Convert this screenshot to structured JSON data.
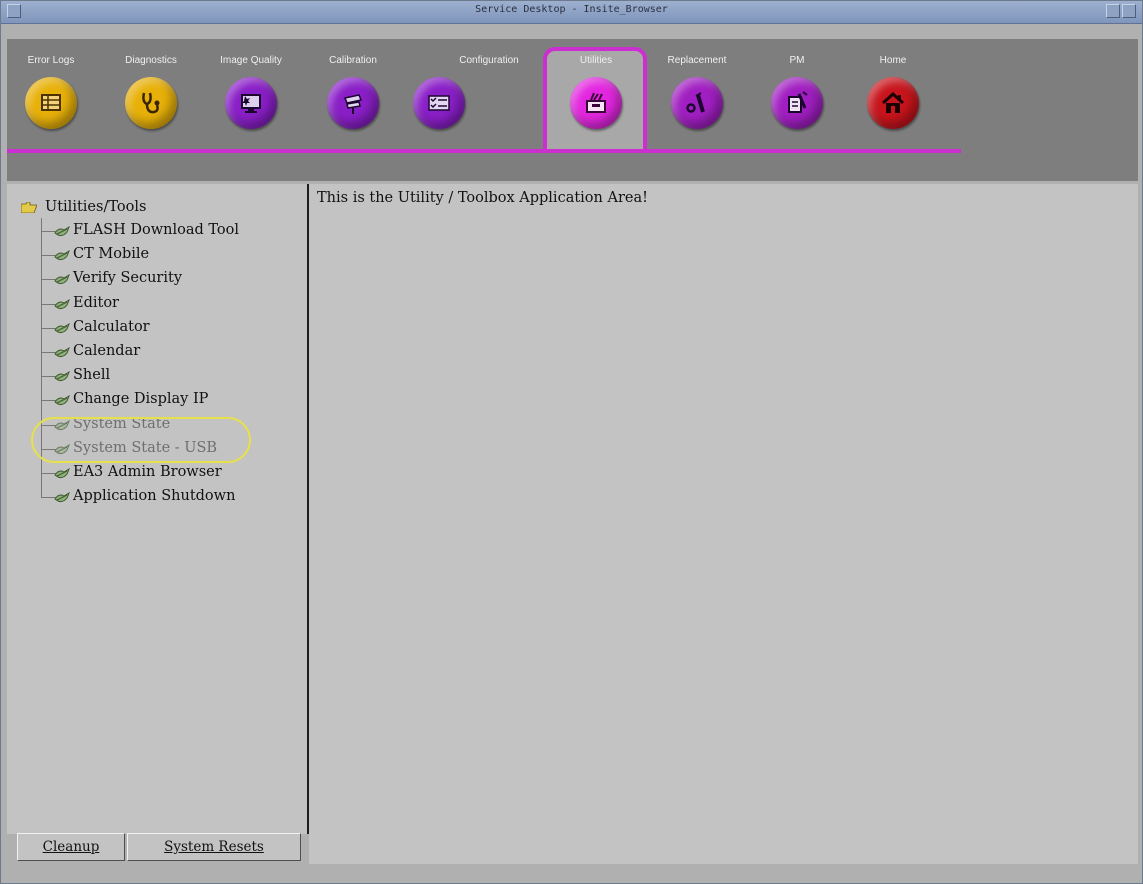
{
  "window": {
    "title": "Service Desktop - Insite_Browser"
  },
  "tabs": [
    {
      "label": "Error Logs",
      "icon": "error-logs-icon",
      "color": "#e8b10a"
    },
    {
      "label": "Diagnostics",
      "icon": "stethoscope-icon",
      "color": "#e8b10a"
    },
    {
      "label": "Image Quality",
      "icon": "monitor-icon",
      "color": "#8a1fc8"
    },
    {
      "label": "Calibration",
      "icon": "calibration-icon",
      "color": "#8a1fc8"
    },
    {
      "label": "Configuration",
      "icon": "checklist-icon",
      "color": "#8a1fc8"
    },
    {
      "label": "Utilities",
      "icon": "toolbox-icon",
      "color": "#e327e0",
      "active": true
    },
    {
      "label": "Replacement",
      "icon": "wrench-icon",
      "color": "#a11fc2"
    },
    {
      "label": "PM",
      "icon": "pm-icon",
      "color": "#a11fc2"
    },
    {
      "label": "Home",
      "icon": "home-icon",
      "color": "#c8141c"
    }
  ],
  "sidebar": {
    "root_label": "Utilities/Tools",
    "items": [
      {
        "label": "FLASH Download Tool"
      },
      {
        "label": "CT Mobile"
      },
      {
        "label": "Verify Security"
      },
      {
        "label": "Editor"
      },
      {
        "label": "Calculator"
      },
      {
        "label": "Calendar"
      },
      {
        "label": "Shell"
      },
      {
        "label": "Change Display IP"
      },
      {
        "label": "System State",
        "disabled": true
      },
      {
        "label": "System State - USB",
        "disabled": true
      },
      {
        "label": "EA3 Admin Browser"
      },
      {
        "label": "Application Shutdown"
      }
    ],
    "buttons": {
      "cleanup": "Cleanup",
      "system_resets": "System Resets"
    }
  },
  "main": {
    "message": "This is the Utility / Toolbox Application Area!"
  },
  "colors": {
    "accent": "#cc2fd0",
    "highlight": "#e6e14a"
  }
}
